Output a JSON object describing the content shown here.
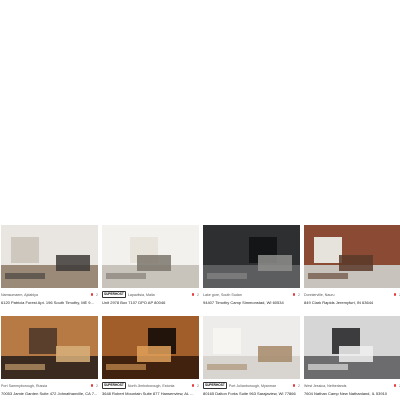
{
  "listings": [
    {
      "badge": "",
      "location": "Namsumaem, Ajdabiya",
      "address": "6120 Patricia Forest Apt. 196 South Timothy, ME 9...",
      "count": "2",
      "palette": [
        "#e9e6e2",
        "#9a8a77",
        "#3d3a37",
        "#cfc8bf"
      ]
    },
    {
      "badge": "SUPERHOST",
      "location": "Lapavitsia, Malia",
      "address": "Unit 2978 Box 7107 DPO AP 80046",
      "count": "2",
      "palette": [
        "#f2f1ee",
        "#c9c4bb",
        "#7b756c",
        "#e8e3db"
      ]
    },
    {
      "badge": "",
      "location": "Lake gore, South Sudan",
      "address": "94407 Timothy Camp Simmonstad, WI 60534",
      "count": "2",
      "palette": [
        "#2e2f31",
        "#5c5d5f",
        "#8e8e8c",
        "#141516"
      ]
    },
    {
      "badge": "",
      "location": "Donnierville, Nauru",
      "address": "849 Clark Rapids Jeremyfurt, IN 63644",
      "count": "2",
      "palette": [
        "#8b4a34",
        "#c8c3bc",
        "#5a3a2a",
        "#e6e2dc"
      ]
    },
    {
      "badge": "",
      "location": "Port Sammyborough, Russia",
      "address": "70053 Jamie Garden Suite 472 Johnathanville, CA 7...",
      "count": "2",
      "palette": [
        "#b77a44",
        "#3b2a1f",
        "#d9b07a",
        "#5a3f2c"
      ]
    },
    {
      "badge": "SUPERHOST",
      "location": "North Jimboborough, Estonia",
      "address": "3648 Robert Mountain Suite 877 Hansenview, AL ...",
      "count": "2",
      "palette": [
        "#a15d2a",
        "#40220f",
        "#e1a15b",
        "#23140b"
      ]
    },
    {
      "badge": "SUPERHOST",
      "location": "Port Julianborough, Myanmar",
      "address": "80165 Dalton Forks Suite 963 Sarajaview, WI 77866",
      "count": "2",
      "palette": [
        "#eeeceb",
        "#d8d4cf",
        "#a68a6a",
        "#f7f5f2"
      ]
    },
    {
      "badge": "",
      "location": "West Jessica, Netherlands",
      "address": "7604 Nathan Camp New Nathanland, IL 53910",
      "count": "2",
      "palette": [
        "#d6d6d6",
        "#6c6c6e",
        "#f0f0f0",
        "#3c3c3e"
      ]
    }
  ]
}
